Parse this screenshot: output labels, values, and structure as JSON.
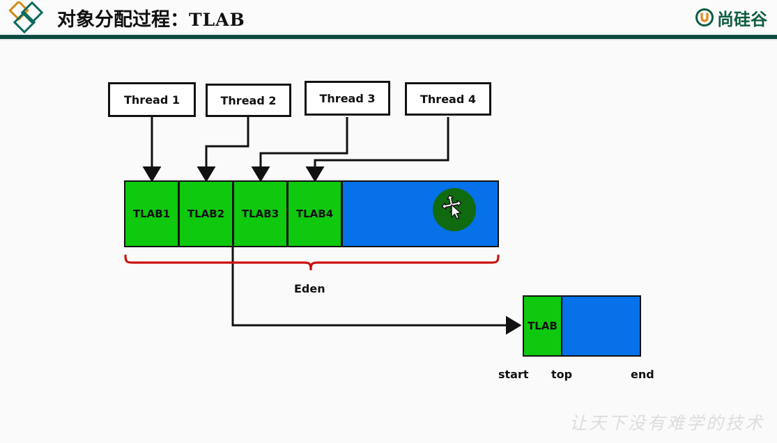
{
  "header": {
    "title_cn": "对象分配过程：",
    "title_latin": "TLAB",
    "logo_text": "尚硅谷",
    "logo_mark_name": "atguigu-u-circle-logo",
    "brand_icon_name": "three-diamonds-logo",
    "colors": {
      "rule": "#0d4b40",
      "diamond_orange": "#d68910",
      "diamond_teal": "#0d6b5e",
      "logo_green": "#0d5c3f",
      "logo_orange": "#e08a1e"
    }
  },
  "diagram": {
    "threads": [
      {
        "label": "Thread 1"
      },
      {
        "label": "Thread 2"
      },
      {
        "label": "Thread 3"
      },
      {
        "label": "Thread 4"
      }
    ],
    "tlab_cells": [
      {
        "label": "TLAB1"
      },
      {
        "label": "TLAB2"
      },
      {
        "label": "TLAB3"
      },
      {
        "label": "TLAB4"
      }
    ],
    "eden_label": "Eden",
    "free_region_name": "eden-free-space",
    "cursor": {
      "name": "move-cursor-highlight",
      "glyph": "four-way-move-arrow-pointer"
    },
    "detail": {
      "tlab_label": "TLAB",
      "markers": [
        {
          "label": "start"
        },
        {
          "label": "top"
        },
        {
          "label": "end"
        }
      ]
    },
    "colors": {
      "tlab_green": "#0ec90e",
      "free_blue": "#0671e8",
      "brace_red": "#cc1111",
      "stroke": "#111111",
      "cursor_halo": "#106b10"
    }
  },
  "watermark": {
    "text": "让天下没有难学的技术"
  }
}
